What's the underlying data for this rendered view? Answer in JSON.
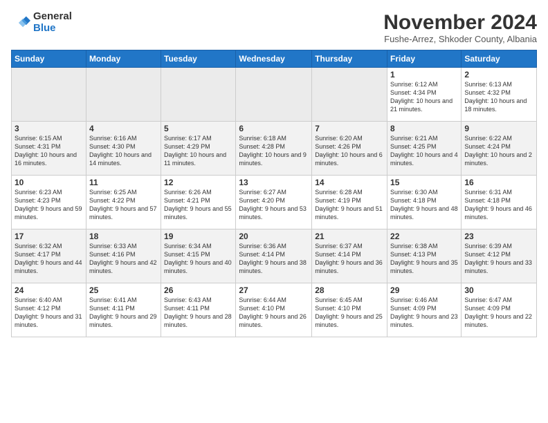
{
  "header": {
    "logo_general": "General",
    "logo_blue": "Blue",
    "month_title": "November 2024",
    "subtitle": "Fushe-Arrez, Shkoder County, Albania"
  },
  "days_of_week": [
    "Sunday",
    "Monday",
    "Tuesday",
    "Wednesday",
    "Thursday",
    "Friday",
    "Saturday"
  ],
  "weeks": [
    [
      {
        "day": "",
        "info": ""
      },
      {
        "day": "",
        "info": ""
      },
      {
        "day": "",
        "info": ""
      },
      {
        "day": "",
        "info": ""
      },
      {
        "day": "",
        "info": ""
      },
      {
        "day": "1",
        "info": "Sunrise: 6:12 AM\nSunset: 4:34 PM\nDaylight: 10 hours and 21 minutes."
      },
      {
        "day": "2",
        "info": "Sunrise: 6:13 AM\nSunset: 4:32 PM\nDaylight: 10 hours and 18 minutes."
      }
    ],
    [
      {
        "day": "3",
        "info": "Sunrise: 6:15 AM\nSunset: 4:31 PM\nDaylight: 10 hours and 16 minutes."
      },
      {
        "day": "4",
        "info": "Sunrise: 6:16 AM\nSunset: 4:30 PM\nDaylight: 10 hours and 14 minutes."
      },
      {
        "day": "5",
        "info": "Sunrise: 6:17 AM\nSunset: 4:29 PM\nDaylight: 10 hours and 11 minutes."
      },
      {
        "day": "6",
        "info": "Sunrise: 6:18 AM\nSunset: 4:28 PM\nDaylight: 10 hours and 9 minutes."
      },
      {
        "day": "7",
        "info": "Sunrise: 6:20 AM\nSunset: 4:26 PM\nDaylight: 10 hours and 6 minutes."
      },
      {
        "day": "8",
        "info": "Sunrise: 6:21 AM\nSunset: 4:25 PM\nDaylight: 10 hours and 4 minutes."
      },
      {
        "day": "9",
        "info": "Sunrise: 6:22 AM\nSunset: 4:24 PM\nDaylight: 10 hours and 2 minutes."
      }
    ],
    [
      {
        "day": "10",
        "info": "Sunrise: 6:23 AM\nSunset: 4:23 PM\nDaylight: 9 hours and 59 minutes."
      },
      {
        "day": "11",
        "info": "Sunrise: 6:25 AM\nSunset: 4:22 PM\nDaylight: 9 hours and 57 minutes."
      },
      {
        "day": "12",
        "info": "Sunrise: 6:26 AM\nSunset: 4:21 PM\nDaylight: 9 hours and 55 minutes."
      },
      {
        "day": "13",
        "info": "Sunrise: 6:27 AM\nSunset: 4:20 PM\nDaylight: 9 hours and 53 minutes."
      },
      {
        "day": "14",
        "info": "Sunrise: 6:28 AM\nSunset: 4:19 PM\nDaylight: 9 hours and 51 minutes."
      },
      {
        "day": "15",
        "info": "Sunrise: 6:30 AM\nSunset: 4:18 PM\nDaylight: 9 hours and 48 minutes."
      },
      {
        "day": "16",
        "info": "Sunrise: 6:31 AM\nSunset: 4:18 PM\nDaylight: 9 hours and 46 minutes."
      }
    ],
    [
      {
        "day": "17",
        "info": "Sunrise: 6:32 AM\nSunset: 4:17 PM\nDaylight: 9 hours and 44 minutes."
      },
      {
        "day": "18",
        "info": "Sunrise: 6:33 AM\nSunset: 4:16 PM\nDaylight: 9 hours and 42 minutes."
      },
      {
        "day": "19",
        "info": "Sunrise: 6:34 AM\nSunset: 4:15 PM\nDaylight: 9 hours and 40 minutes."
      },
      {
        "day": "20",
        "info": "Sunrise: 6:36 AM\nSunset: 4:14 PM\nDaylight: 9 hours and 38 minutes."
      },
      {
        "day": "21",
        "info": "Sunrise: 6:37 AM\nSunset: 4:14 PM\nDaylight: 9 hours and 36 minutes."
      },
      {
        "day": "22",
        "info": "Sunrise: 6:38 AM\nSunset: 4:13 PM\nDaylight: 9 hours and 35 minutes."
      },
      {
        "day": "23",
        "info": "Sunrise: 6:39 AM\nSunset: 4:12 PM\nDaylight: 9 hours and 33 minutes."
      }
    ],
    [
      {
        "day": "24",
        "info": "Sunrise: 6:40 AM\nSunset: 4:12 PM\nDaylight: 9 hours and 31 minutes."
      },
      {
        "day": "25",
        "info": "Sunrise: 6:41 AM\nSunset: 4:11 PM\nDaylight: 9 hours and 29 minutes."
      },
      {
        "day": "26",
        "info": "Sunrise: 6:43 AM\nSunset: 4:11 PM\nDaylight: 9 hours and 28 minutes."
      },
      {
        "day": "27",
        "info": "Sunrise: 6:44 AM\nSunset: 4:10 PM\nDaylight: 9 hours and 26 minutes."
      },
      {
        "day": "28",
        "info": "Sunrise: 6:45 AM\nSunset: 4:10 PM\nDaylight: 9 hours and 25 minutes."
      },
      {
        "day": "29",
        "info": "Sunrise: 6:46 AM\nSunset: 4:09 PM\nDaylight: 9 hours and 23 minutes."
      },
      {
        "day": "30",
        "info": "Sunrise: 6:47 AM\nSunset: 4:09 PM\nDaylight: 9 hours and 22 minutes."
      }
    ]
  ]
}
